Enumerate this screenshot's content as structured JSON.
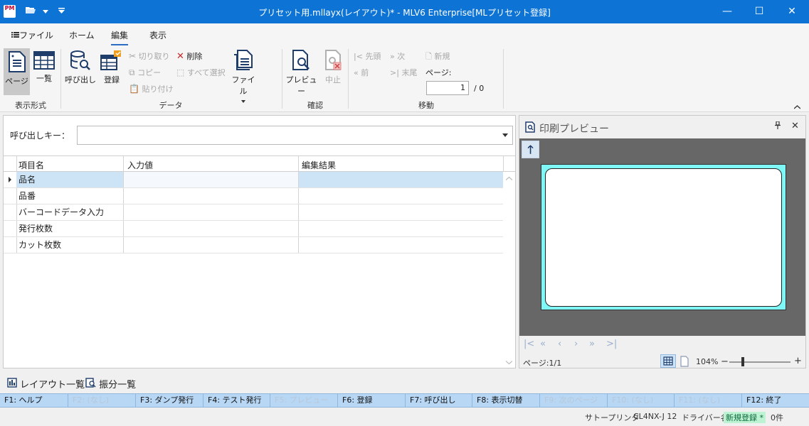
{
  "titlebar": {
    "app_icon_text": "PM",
    "title": "プリセット用.mllayx(レイアウト)* - MLV6 Enterprise[MLプリセット登録]",
    "minimize": "—",
    "maximize": "☐",
    "close": "✕"
  },
  "menu": {
    "tabs": [
      {
        "label": "ファイル"
      },
      {
        "label": "ホーム"
      },
      {
        "label": "編集"
      },
      {
        "label": "表示"
      }
    ]
  },
  "ribbon": {
    "groups": [
      {
        "label": "表示形式"
      },
      {
        "label": "データ"
      },
      {
        "label": "確認"
      },
      {
        "label": "移動"
      }
    ],
    "buttons": {
      "page": "ページ",
      "list": "一覧",
      "call": "呼び出し",
      "register": "登録",
      "cut": "切り取り",
      "copy": "コピー",
      "paste": "貼り付け",
      "delete": "削除",
      "select_all": "すべて選択",
      "file": "ファイル",
      "preview": "プレビュー",
      "stop": "中止",
      "first": "先頭",
      "next": "次",
      "new": "新規",
      "prev": "前",
      "last": "末尾",
      "page_label": "ページ:",
      "page_value": "1",
      "page_total": "/ 0"
    }
  },
  "form": {
    "key_label": "呼び出しキー：",
    "key_value": ""
  },
  "grid": {
    "headers": [
      "項目名",
      "入力値",
      "編集結果"
    ],
    "rows": [
      {
        "name": "品名"
      },
      {
        "name": "品番"
      },
      {
        "name": "バーコードデータ入力"
      },
      {
        "name": "発行枚数"
      },
      {
        "name": "カット枚数"
      }
    ]
  },
  "preview": {
    "title": "印刷プレビュー",
    "pin": "ꟷ",
    "close": "✕",
    "page_label": "ページ:1/1",
    "zoom": "104%"
  },
  "bottom_links": {
    "layout_list": "レイアウト一覧",
    "sort_list": "振分一覧"
  },
  "fkeys": [
    {
      "label": "F1: ヘルプ",
      "enabled": true
    },
    {
      "label": "F2: (なし)",
      "enabled": false
    },
    {
      "label": "F3: ダンプ発行",
      "enabled": true
    },
    {
      "label": "F4: テスト発行",
      "enabled": true
    },
    {
      "label": "F5: プレビュー",
      "enabled": false
    },
    {
      "label": "F6: 登録",
      "enabled": true
    },
    {
      "label": "F7: 呼び出し",
      "enabled": true
    },
    {
      "label": "F8: 表示切替",
      "enabled": true
    },
    {
      "label": "F9: 次のページ",
      "enabled": false
    },
    {
      "label": "F10: (なし)",
      "enabled": false
    },
    {
      "label": "F11: (なし)",
      "enabled": false
    },
    {
      "label": "F12: 終了",
      "enabled": true
    }
  ],
  "status": {
    "printer": "サトープリンタ",
    "model": "CL4NX-J 12",
    "driver": "ドライバー名",
    "mode": "新規登録 *",
    "count": "0件"
  },
  "colors": {
    "titlebar": "#0d74d6",
    "fkeys": "#b7d7f5",
    "label_bg": "#7ff7f7",
    "selected_row": "#cde4f7"
  }
}
